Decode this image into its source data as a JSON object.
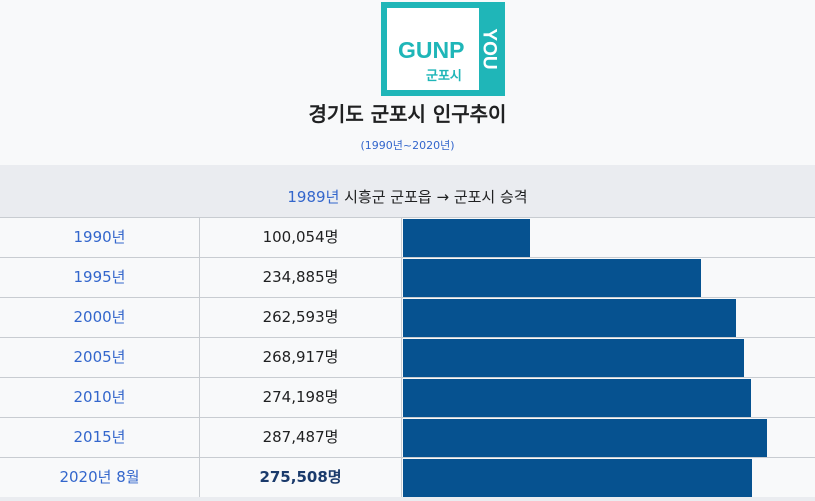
{
  "logo": {
    "wordmark": "GUNP",
    "sub_label": "군포시",
    "side_text": "YOU",
    "accent_color": "#1fb6b8"
  },
  "title": "경기도 군포시 인구추이",
  "subtitle": "(1990년~2020년)",
  "caption": {
    "year_link": "1989년",
    "text": " 시흥군 군포읍 → 군포시 승격"
  },
  "bar_color": "#065290",
  "rows": [
    {
      "year": "1990년",
      "population": "100,054명",
      "value": 100054,
      "bold": false
    },
    {
      "year": "1995년",
      "population": "234,885명",
      "value": 234885,
      "bold": false
    },
    {
      "year": "2000년",
      "population": "262,593명",
      "value": 262593,
      "bold": false
    },
    {
      "year": "2005년",
      "population": "268,917명",
      "value": 268917,
      "bold": false
    },
    {
      "year": "2010년",
      "population": "274,198명",
      "value": 274198,
      "bold": false
    },
    {
      "year": "2015년",
      "population": "287,487명",
      "value": 287487,
      "bold": false
    },
    {
      "year": "2020년 8월",
      "population": "275,508명",
      "value": 275508,
      "bold": true
    }
  ],
  "bar_scale_max": 325000
}
